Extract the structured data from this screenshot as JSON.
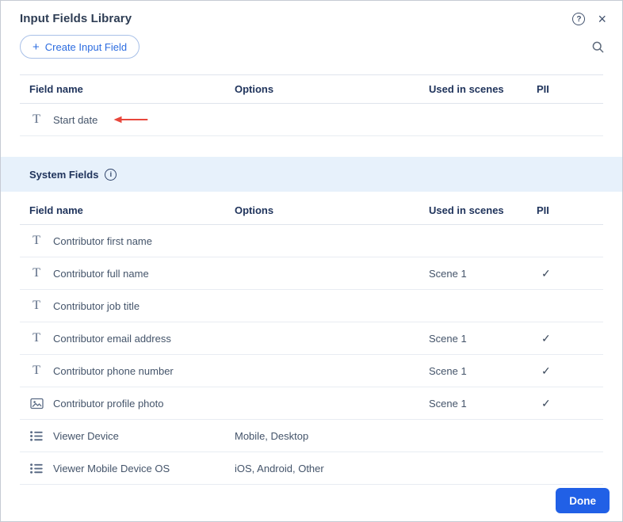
{
  "header": {
    "title": "Input Fields Library",
    "help_glyph": "?",
    "close_glyph": "×"
  },
  "toolbar": {
    "plus_glyph": "+",
    "create_label": "Create Input Field"
  },
  "table": {
    "columns": [
      "Field name",
      "Options",
      "Used in scenes",
      "PII"
    ],
    "pii_check": "✓"
  },
  "custom_fields": {
    "rows": [
      {
        "icon": "text-field-icon",
        "name": "Start date",
        "options": "",
        "used_in": "",
        "pii": false,
        "annotation": "red-arrow-left"
      }
    ]
  },
  "system_section": {
    "label": "System Fields",
    "info_glyph": "i"
  },
  "system_fields": {
    "rows": [
      {
        "icon": "text-field-icon",
        "name": "Contributor first name",
        "options": "",
        "used_in": "",
        "pii": false
      },
      {
        "icon": "text-field-icon",
        "name": "Contributor full name",
        "options": "",
        "used_in": "Scene 1",
        "pii": true
      },
      {
        "icon": "text-field-icon",
        "name": "Contributor job title",
        "options": "",
        "used_in": "",
        "pii": false
      },
      {
        "icon": "text-field-icon",
        "name": "Contributor email address",
        "options": "",
        "used_in": "Scene 1",
        "pii": true
      },
      {
        "icon": "text-field-icon",
        "name": "Contributor phone number",
        "options": "",
        "used_in": "Scene 1",
        "pii": true
      },
      {
        "icon": "photo-field-icon",
        "name": "Contributor profile photo",
        "options": "",
        "used_in": "Scene 1",
        "pii": true
      },
      {
        "icon": "list-field-icon",
        "name": "Viewer Device",
        "options": "Mobile, Desktop",
        "used_in": "",
        "pii": false
      },
      {
        "icon": "list-field-icon",
        "name": "Viewer Mobile Device OS",
        "options": "iOS, Android, Other",
        "used_in": "",
        "pii": false
      }
    ]
  },
  "footer": {
    "done_label": "Done"
  },
  "colors": {
    "accent_blue": "#2c6ce0",
    "done_blue": "#2160e6",
    "section_bg": "#e7f1fb",
    "header_text": "#20345c",
    "body_text": "#44546a",
    "border": "#dfe4ec",
    "annotation_red": "#e8473c"
  }
}
